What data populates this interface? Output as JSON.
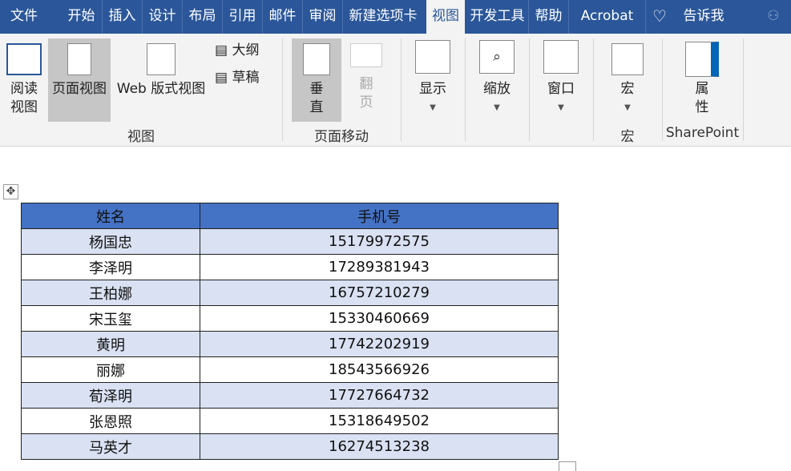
{
  "tabs": [
    "文件",
    "开始",
    "插入",
    "设计",
    "布局",
    "引用",
    "邮件",
    "审阅",
    "新建选项卡",
    "视图",
    "开发工具",
    "帮助",
    "Acrobat",
    "告诉我"
  ],
  "active_tab": "视图",
  "ribbon": {
    "read_mode": [
      "阅读",
      "视图"
    ],
    "print_layout": "页面视图",
    "web_layout": "Web 版式视图",
    "outline": "大纲",
    "draft": "草稿",
    "group_views": "视图",
    "vertical": [
      "垂",
      "直"
    ],
    "side_to_side": [
      "翻",
      "页"
    ],
    "group_page_movement": "页面移动",
    "show": "显示",
    "zoom": "缩放",
    "window": "窗口",
    "macros": "宏",
    "group_macros": "宏",
    "properties": [
      "属",
      "性"
    ],
    "group_sharepoint": "SharePoint"
  },
  "table": {
    "headers": [
      "姓名",
      "手机号"
    ],
    "rows": [
      [
        "杨国忠",
        "15179972575"
      ],
      [
        "李泽明",
        "17289381943"
      ],
      [
        "王柏娜",
        "16757210279"
      ],
      [
        "宋玉玺",
        "15330460669"
      ],
      [
        "黄明",
        "17742202919"
      ],
      [
        "丽娜",
        "18543566926"
      ],
      [
        "荀泽明",
        "17727664732"
      ],
      [
        "张恩照",
        "15318649502"
      ],
      [
        "马英才",
        "16274513238"
      ]
    ]
  },
  "colors": {
    "tabbar": "#2b579a",
    "header": "#4472c4",
    "band": "#d9e1f2"
  }
}
